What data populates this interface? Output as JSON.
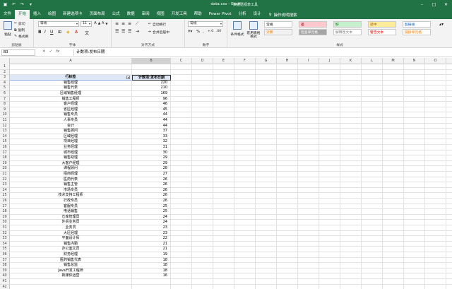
{
  "window": {
    "title": "data.csv  -  Excel",
    "context_tab_title": "数据透视表工具"
  },
  "menu": {
    "tabs": [
      "文件",
      "开始",
      "插入",
      "绘图",
      "新建选项卡",
      "页面布局",
      "公式",
      "数据",
      "审阅",
      "视图",
      "开发工具",
      "帮助",
      "Power Pivot",
      "分析",
      "设计"
    ],
    "active": "开始",
    "tell_me": "操作说明搜索"
  },
  "ribbon": {
    "clipboard": {
      "paste": "粘贴",
      "cut": "剪切",
      "copy": "复制",
      "format_painter": "格式刷",
      "label": "剪贴板"
    },
    "font": {
      "name": "等线",
      "size": "11",
      "label": "字体"
    },
    "alignment": {
      "wrap": "自动换行",
      "merge": "合并后居中",
      "label": "对齐方式"
    },
    "number": {
      "format": "常规",
      "label": "数字"
    },
    "styles": {
      "conditional": "条件格式",
      "table": "套用表格格式",
      "cells": [
        {
          "text": "常规",
          "bg": "#ffffff",
          "fg": "#000000"
        },
        {
          "text": "差",
          "bg": "#ffc7ce",
          "fg": "#9c0006"
        },
        {
          "text": "好",
          "bg": "#c6efce",
          "fg": "#006100"
        },
        {
          "text": "适中",
          "bg": "#ffeb9c",
          "fg": "#9c5700"
        },
        {
          "text": "超链接",
          "bg": "#ffffff",
          "fg": "#0563c1"
        },
        {
          "text": "计算",
          "bg": "#f2f2f2",
          "fg": "#fa7d00"
        },
        {
          "text": "检查单元格",
          "bg": "#a5a5a5",
          "fg": "#ffffff"
        },
        {
          "text": "解释性文本",
          "bg": "#ffffff",
          "fg": "#7f7f7f"
        },
        {
          "text": "警告文本",
          "bg": "#ffffff",
          "fg": "#ff0000"
        },
        {
          "text": "链接单元格",
          "bg": "#ffffff",
          "fg": "#fa7d00"
        }
      ],
      "label": "样式"
    }
  },
  "formula_bar": {
    "name_box": "B3",
    "fx": "fx",
    "value": "计数项:发布日期"
  },
  "columns": [
    "A",
    "B",
    "C",
    "D",
    "E",
    "F",
    "G",
    "H",
    "I",
    "J",
    "K",
    "L",
    "M",
    "N",
    "O"
  ],
  "pivot": {
    "header_label": "行标签",
    "header_value": "计数项:发布日期",
    "rows": [
      [
        "销售经理",
        "220"
      ],
      [
        "销售代表",
        "210"
      ],
      [
        "区域销售经理",
        "169"
      ],
      [
        "销售工程师",
        "96"
      ],
      [
        "客户经理",
        "46"
      ],
      [
        "省区经理",
        "45"
      ],
      [
        "销售专员",
        "44"
      ],
      [
        "人事专员",
        "44"
      ],
      [
        "会计",
        "44"
      ],
      [
        "销售顾问",
        "37"
      ],
      [
        "区域经理",
        "33"
      ],
      [
        "项目经理",
        "32"
      ],
      [
        "业务经理",
        "31"
      ],
      [
        "城市经理",
        "30"
      ],
      [
        "销售助理",
        "29"
      ],
      [
        "大客户经理",
        "29"
      ],
      [
        "课程顾问",
        "28"
      ],
      [
        "招商经理",
        "27"
      ],
      [
        "医药代表",
        "26"
      ],
      [
        "销售主管",
        "26"
      ],
      [
        "市场专员",
        "26"
      ],
      [
        "技术支持工程师",
        "26"
      ],
      [
        "行政专员",
        "26"
      ],
      [
        "客服专员",
        "25"
      ],
      [
        "电话销售",
        "25"
      ],
      [
        "仓库管理员",
        "24"
      ],
      [
        "外贸业务员",
        "24"
      ],
      [
        "业务员",
        "23"
      ],
      [
        "大区经理",
        "23"
      ],
      [
        "平面设计师",
        "22"
      ],
      [
        "销售内勤",
        "21"
      ],
      [
        "办公室文员",
        "21"
      ],
      [
        "财务经理",
        "19"
      ],
      [
        "医药销售代表",
        "18"
      ],
      [
        "销售总监",
        "18"
      ],
      [
        "Java开发工程师",
        "18"
      ],
      [
        "新媒体运营",
        "16"
      ]
    ]
  }
}
